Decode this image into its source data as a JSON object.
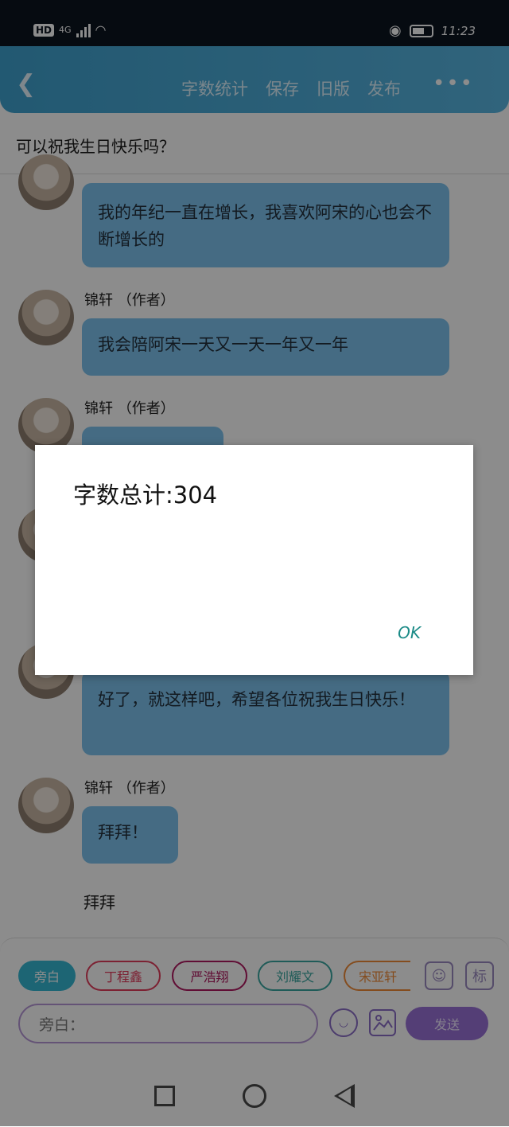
{
  "status": {
    "network": "4G",
    "time": "11:23"
  },
  "topbar": {
    "back_icon": "back-chevron-icon",
    "menu": [
      "字数统计",
      "保存",
      "旧版",
      "发布"
    ],
    "more_icon": "more-dots-icon"
  },
  "question": "可以祝我生日快乐吗？",
  "messages": [
    {
      "text": "我的年纪一直在增长，我喜欢阿宋的心也会不断增长的"
    },
    {
      "author": "锦轩 （作者）",
      "text": "我会陪阿宋一天又一天一年又一年"
    },
    {
      "author": "锦轩 （作者）",
      "text": ""
    },
    {
      "text": "好了，就这样吧，希望各位祝我生日快乐！"
    },
    {
      "author": "锦轩 （作者）",
      "text": "拜拜！"
    }
  ],
  "narration": "拜拜",
  "dialog": {
    "message": "字数总计:304",
    "ok": "OK"
  },
  "composer": {
    "chips": [
      {
        "label": "旁白"
      },
      {
        "label": "丁程鑫"
      },
      {
        "label": "严浩翔"
      },
      {
        "label": "刘耀文"
      },
      {
        "label": "宋亚轩"
      }
    ],
    "placeholder": "旁白：",
    "send": "发送",
    "icons": [
      "person-icon",
      "tag-icon",
      "emoji-icon",
      "image-icon"
    ]
  }
}
